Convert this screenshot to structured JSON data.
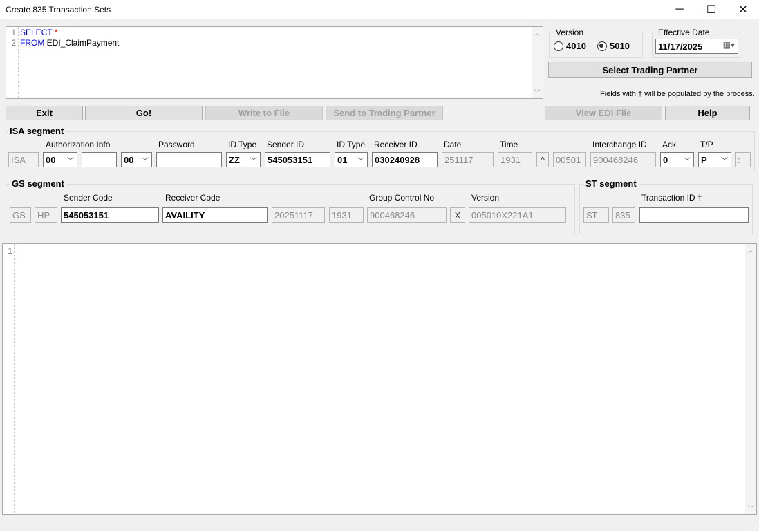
{
  "window": {
    "title": "Create 835 Transaction Sets",
    "minimize": "─",
    "maximize": "☐",
    "close": "✕"
  },
  "query": {
    "lines": [
      {
        "num": "1",
        "keyword": "SELECT",
        "rest": "*"
      },
      {
        "num": "2",
        "keyword": "FROM",
        "rest": "EDI_ClaimPayment"
      }
    ]
  },
  "version": {
    "label": "Version",
    "option_4010": "4010",
    "option_5010": "5010",
    "selected": "5010"
  },
  "effective_date": {
    "label": "Effective Date",
    "value": "11/17/2025"
  },
  "select_trading_partner": "Select Trading Partner",
  "note": "Fields with † will be populated by the process.",
  "buttons": {
    "exit": "Exit",
    "go": "Go!",
    "write_to_file": "Write to File",
    "send_to_trading_partner": "Send to Trading Partner",
    "view_edi_file": "View EDI File",
    "help": "Help"
  },
  "isa": {
    "title": "ISA segment",
    "labels": {
      "authorization_info": "Authorization Info",
      "password": "Password",
      "id_type_1": "ID Type",
      "sender_id": "Sender ID",
      "id_type_2": "ID Type",
      "receiver_id": "Receiver ID",
      "date": "Date",
      "time": "Time",
      "interchange_id": "Interchange ID",
      "ack": "Ack",
      "tp": "T/P"
    },
    "values": {
      "segment": "ISA",
      "auth_qualifier": "00",
      "auth_info": "",
      "password_qualifier": "00",
      "password": "",
      "sender_id_type": "ZZ",
      "sender_id": "545053151",
      "receiver_id_type": "01",
      "receiver_id": "030240928",
      "date": "251117",
      "time": "1931",
      "repetition_sep": "^",
      "control_version": "00501",
      "interchange_id": "900468246",
      "ack": "0",
      "tp": "P",
      "component_sep": ":"
    }
  },
  "gs": {
    "title": "GS segment",
    "labels": {
      "sender_code": "Sender Code",
      "receiver_code": "Receiver Code",
      "group_control_no": "Group Control No",
      "version": "Version"
    },
    "values": {
      "segment": "GS",
      "functional_id": "HP",
      "sender_code": "545053151",
      "receiver_code": "AVAILITY",
      "date": "20251117",
      "time": "1931",
      "group_control_no": "900468246",
      "agency": "X",
      "version": "005010X221A1"
    }
  },
  "st": {
    "title": "ST segment",
    "labels": {
      "transaction_id": "Transaction ID †"
    },
    "values": {
      "segment": "ST",
      "id": "835",
      "transaction_id": ""
    }
  },
  "output": {
    "line_number": "1"
  },
  "icons": {
    "calendar": "calendar-icon",
    "resize_grip": "resize-grip-icon"
  }
}
